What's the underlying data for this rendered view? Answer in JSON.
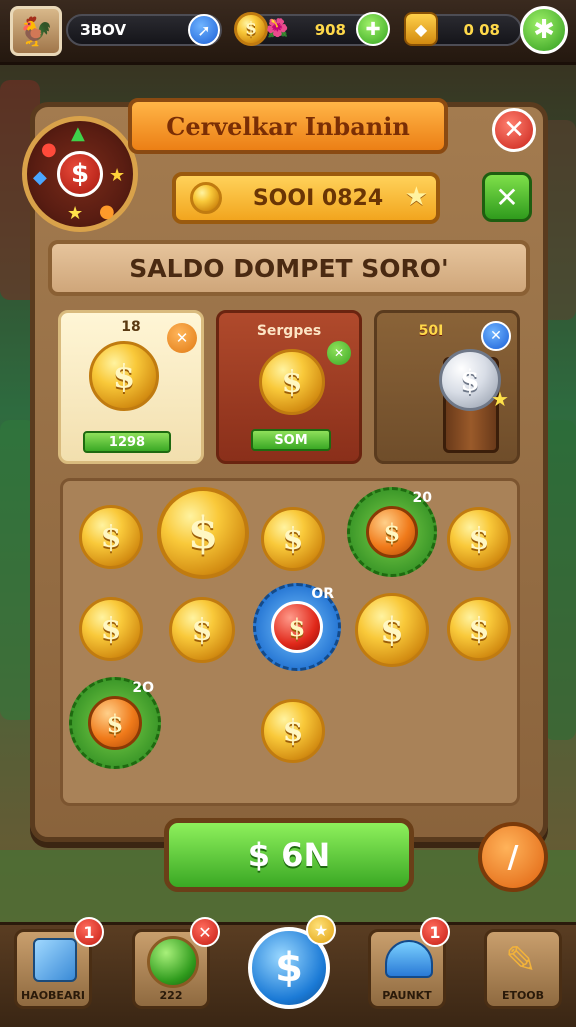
{
  "topbar": {
    "avatar_icon": "rooster-avatar-icon",
    "player_name": "ЗBOV",
    "share_icon": "arrow-icon",
    "coin_icon": "coin-icon",
    "balance_value": "908",
    "plus_icon": "green-plus-icon",
    "gem_icon": "gem-chest-icon",
    "gem_value": "0 08",
    "settings_icon": "green-gear-icon"
  },
  "dialog": {
    "title": "Cervelkar Inbanin",
    "close_icon": "close-icon",
    "close_glyph": "✕",
    "badge_symbol": "$",
    "balance_display": "SOOI 0824",
    "confirm_glyph": "✕",
    "wallet_header": "SALDO DOMPET SORO'",
    "cards": [
      {
        "label": "18",
        "price": "1298",
        "corner_glyph": "✕"
      },
      {
        "label": "Sergpes",
        "price": "SOM",
        "corner_glyph": "✕"
      },
      {
        "label": "50I",
        "price": "",
        "corner_glyph": "✕"
      }
    ],
    "coin_symbol": "$",
    "stamp_labels": [
      "20",
      "OR",
      "2O"
    ],
    "pay_button": "$ 6N",
    "edit_glyph": "/"
  },
  "bottom_nav": [
    {
      "label": "HAOBEARI",
      "badge": "1",
      "icon": "cube-icon"
    },
    {
      "label": "222",
      "badge": "✕",
      "icon": "green-ball-icon"
    },
    {
      "label": "",
      "badge": "★",
      "icon": "dollar-coin-icon"
    },
    {
      "label": "PAUNKT",
      "badge": "1",
      "icon": "helmet-icon"
    },
    {
      "label": "ETOOB",
      "badge": "",
      "icon": "pencil-icon"
    }
  ],
  "colors": {
    "accent_orange": "#ec7f15",
    "coin_gold": "#f9c93a",
    "button_green": "#3aa824",
    "close_red": "#c9231a",
    "panel_brown": "#a37b4f"
  }
}
